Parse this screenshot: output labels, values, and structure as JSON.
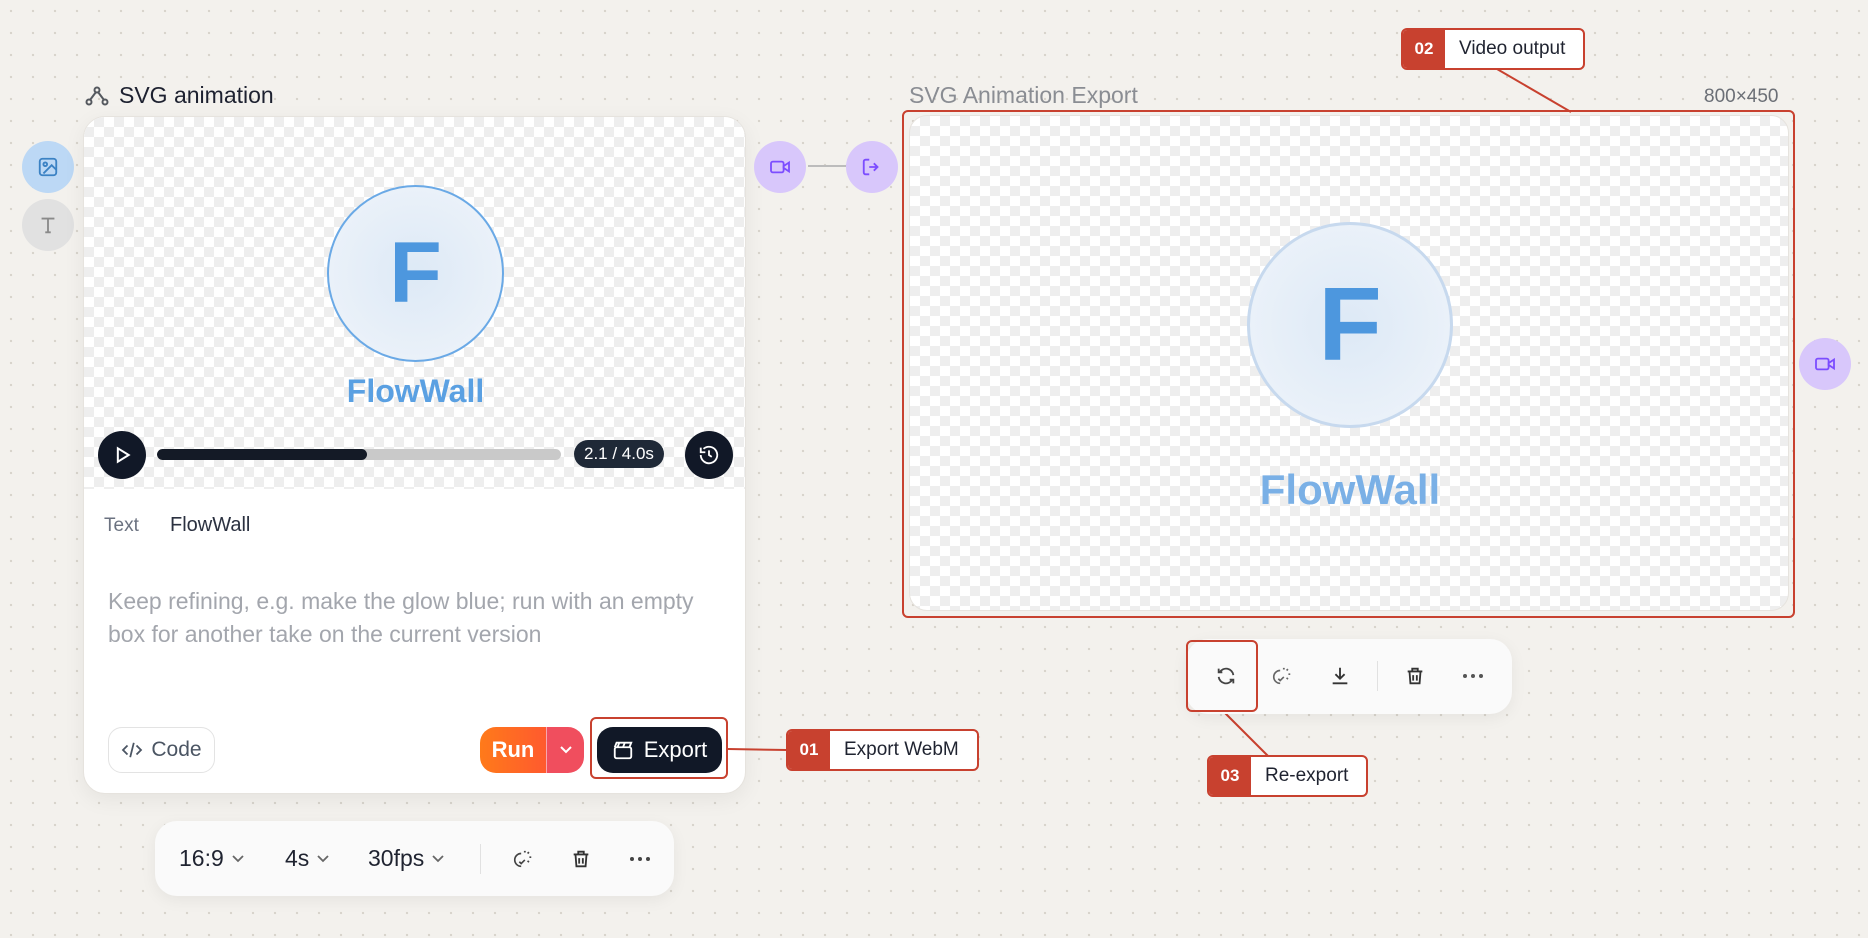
{
  "left_rail": {
    "items": [
      {
        "name": "image-icon",
        "active": true
      },
      {
        "name": "text-icon",
        "active": false
      }
    ]
  },
  "left_node": {
    "title": "SVG animation",
    "preview": {
      "logo_letter": "F",
      "logo_word": "FlowWall",
      "progress": 0.52,
      "time": "2.1 / 4.0s"
    },
    "text_label": "Text",
    "text_value": "FlowWall",
    "prompt_placeholder": "Keep refining, e.g. make the glow blue; run with an empty box for another take on the current version",
    "code_label": "Code",
    "run_label": "Run",
    "export_label": "Export"
  },
  "left_toolbar": {
    "aspect": "16:9",
    "duration": "4s",
    "fps": "30fps"
  },
  "right_node": {
    "title": "SVG Animation Export",
    "dimensions": "800×450",
    "preview": {
      "logo_letter": "F",
      "logo_word": "FlowWall"
    }
  },
  "annotations": [
    {
      "number": "01",
      "label": "Export WebM"
    },
    {
      "number": "02",
      "label": "Video output"
    },
    {
      "number": "03",
      "label": "Re-export"
    }
  ],
  "colors": {
    "accent_red": "#c8412f",
    "port_purple": "#d8c7fb",
    "logo_blue": "#4d97de",
    "run_orange": "#ff7a1a"
  }
}
